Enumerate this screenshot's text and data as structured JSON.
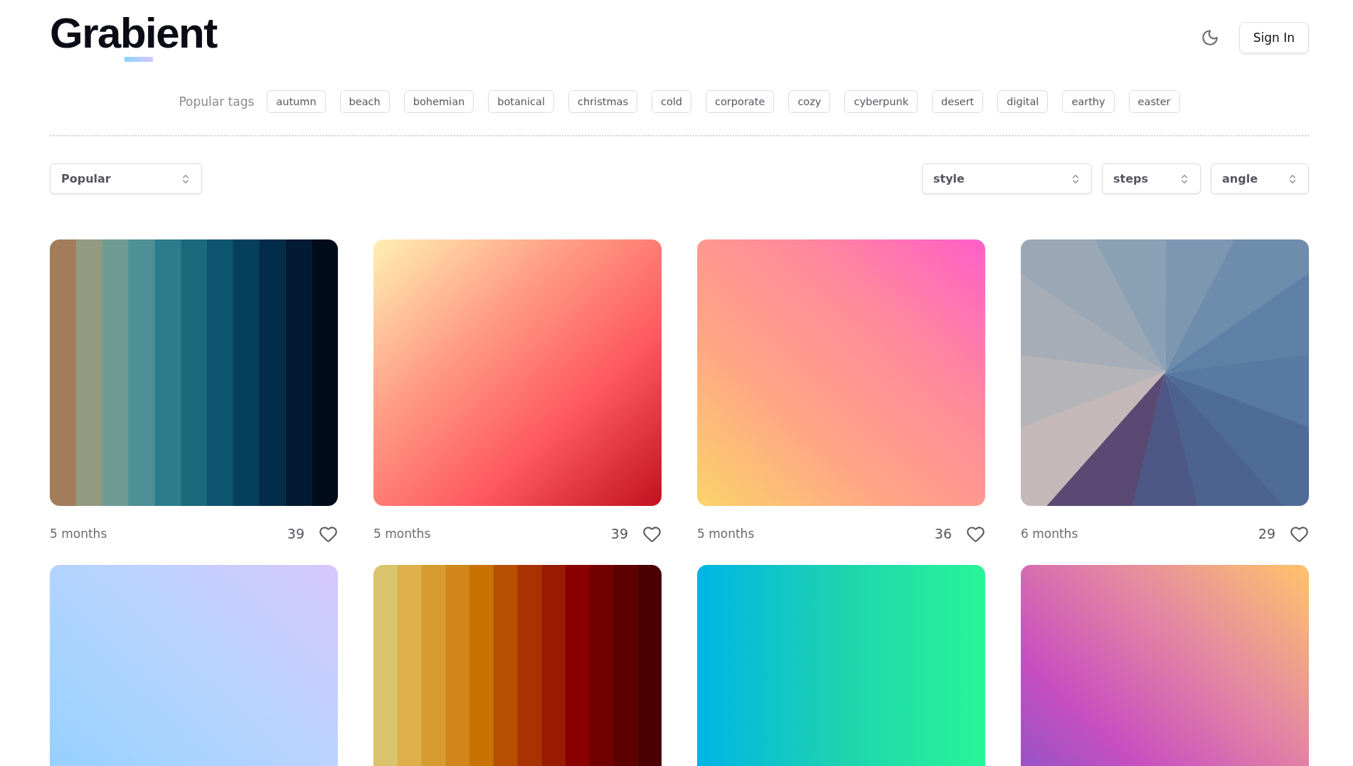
{
  "header": {
    "logo": "Grabient",
    "sign_in": "Sign In"
  },
  "tags": {
    "label": "Popular tags",
    "items": [
      "autumn",
      "beach",
      "bohemian",
      "botanical",
      "christmas",
      "cold",
      "corporate",
      "cozy",
      "cyberpunk",
      "desert",
      "digital",
      "earthy",
      "easter"
    ]
  },
  "filters": {
    "sort": "Popular",
    "selects": [
      "style",
      "steps",
      "angle"
    ]
  },
  "cards": [
    {
      "swatch": {
        "kind": "picture"
      },
      "age": "5 months",
      "likes": "39"
    },
    {
      "swatch": {
        "kind": "picture"
      },
      "age": "5 months",
      "likes": "39"
    },
    {
      "swatch": {
        "kind": "picture"
      },
      "age": "5 months",
      "likes": "36"
    },
    {
      "swatch": {
        "kind": "picture"
      },
      "age": "6 months",
      "likes": "29"
    },
    {
      "swatch": {
        "kind": "picture"
      }
    },
    {
      "swatch": {
        "kind": "picture"
      }
    },
    {
      "swatch": {
        "kind": "picture"
      }
    },
    {
      "swatch": {
        "kind": "picture"
      }
    }
  ]
}
